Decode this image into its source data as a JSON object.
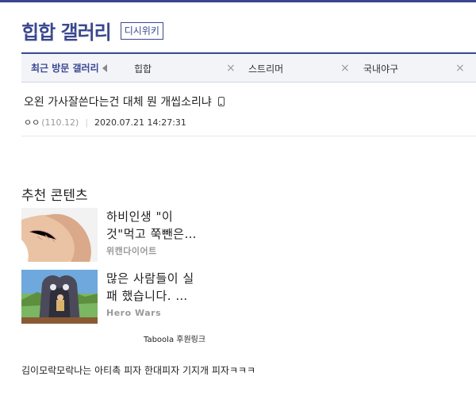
{
  "header": {
    "gallery_title": "힙합 갤러리",
    "wiki_badge": "디시위키",
    "accent_color": "#3b4890"
  },
  "recent_visits": {
    "label": "최근 방문 갤러리",
    "items": [
      {
        "name": "힙합",
        "close": "×"
      },
      {
        "name": "스트리머",
        "close": "×"
      },
      {
        "name": "국내야구",
        "close": "×"
      }
    ]
  },
  "post": {
    "title": "오왼 가사잘쓴다는건 대체 뭔 개씹소리냐",
    "device_icon": "mobile-phone-icon",
    "author": "ㅇㅇ",
    "ip": "(110.12)",
    "separator": "|",
    "datetime": "2020.07.21 14:27:31"
  },
  "recommended": {
    "title": "추천 콘텐츠",
    "items": [
      {
        "line1": "하비인생 \"이",
        "line2": "것\"먹고 쭉뺀은…",
        "source": "위캔다이어트"
      },
      {
        "line1": "많은 사람들이 실",
        "line2": "패 했습니다. …",
        "source": "Hero Wars"
      }
    ],
    "sponsor": "Taboola 후원링크"
  },
  "comment": {
    "text": "김이모락모락나는 아티촉 피자 한대피자 기지개 피자ㅋㅋㅋ"
  }
}
